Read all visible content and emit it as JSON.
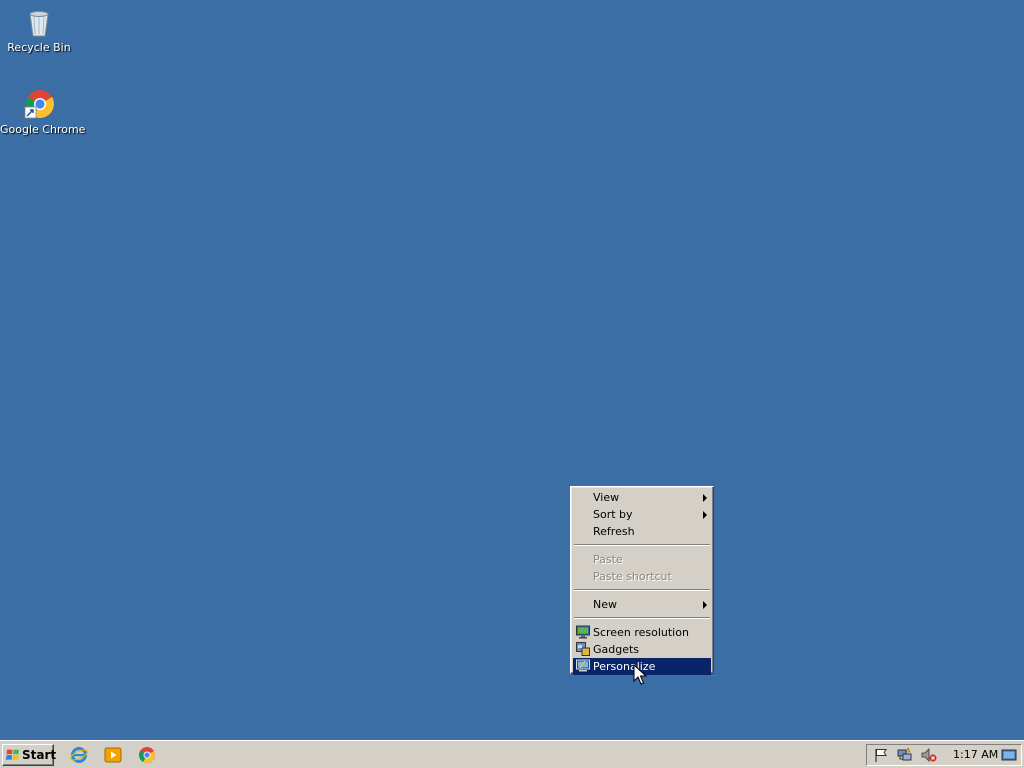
{
  "desktop": {
    "icons": [
      {
        "label": "Recycle Bin",
        "icon": "recycle-bin-icon"
      },
      {
        "label": "Google Chrome",
        "icon": "chrome-icon"
      }
    ]
  },
  "context_menu": {
    "items": {
      "view": {
        "label": "View",
        "submenu": true
      },
      "sort_by": {
        "label": "Sort by",
        "submenu": true
      },
      "refresh": {
        "label": "Refresh"
      },
      "paste": {
        "label": "Paste",
        "disabled": true
      },
      "paste_shortcut": {
        "label": "Paste shortcut",
        "disabled": true
      },
      "new": {
        "label": "New",
        "submenu": true
      },
      "screen_resolution": {
        "label": "Screen resolution",
        "icon": "monitor-icon"
      },
      "gadgets": {
        "label": "Gadgets",
        "icon": "gadgets-icon"
      },
      "personalize": {
        "label": "Personalize",
        "icon": "personalize-icon",
        "highlighted": true
      }
    }
  },
  "taskbar": {
    "start_label": "Start",
    "quick_launch": [
      "internet-explorer-icon",
      "media-player-icon",
      "chrome-icon"
    ],
    "tray_icons": [
      "action-center-flag-icon",
      "network-icon",
      "volume-muted-icon"
    ],
    "clock": "1:17 AM"
  },
  "colors": {
    "desktop": "#3a6ea5",
    "menu_bg": "#d4d0c8",
    "highlight": "#0a246a"
  }
}
